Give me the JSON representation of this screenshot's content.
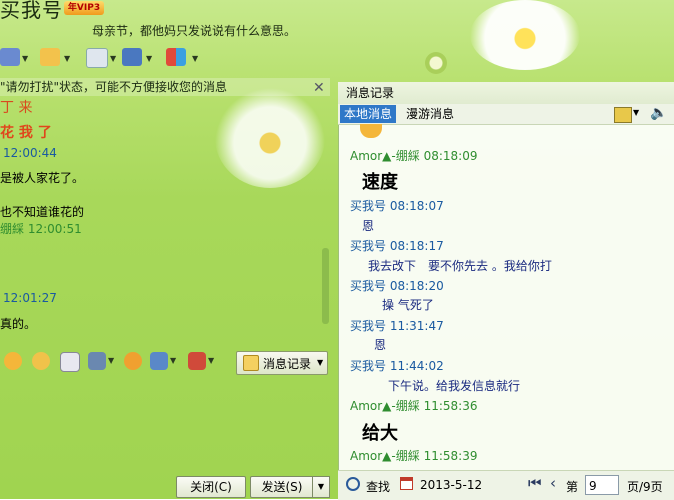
{
  "header": {
    "contact_name": "买我号",
    "vip_badge": "年VIP3",
    "signature": "母亲节，都他妈只发说说有什么意思。"
  },
  "notice": {
    "text": "\"请勿打扰\"状态，可能不方便接收您的消息"
  },
  "left_chat": {
    "lines": [
      {
        "text": "丁 来"
      },
      {
        "text": "花 我 了"
      },
      {
        "text": "12:00:44"
      },
      {
        "text": "是被人家花了。"
      },
      {
        "text": "也不知道谁花的"
      },
      {
        "text": "绷綵  12:00:51"
      },
      {
        "text": "12:01:27"
      },
      {
        "text": "真的。"
      }
    ]
  },
  "toolbar": {
    "history_label": "消息记录",
    "close_label": "关闭(C)",
    "send_label": "发送(S)"
  },
  "history_panel": {
    "title": "消息记录",
    "tabs": [
      {
        "label": "本地消息"
      },
      {
        "label": "漫游消息"
      }
    ],
    "messages": [
      {
        "sender": "Amor▲-绷綵",
        "time": "08:18:09",
        "text": "速度"
      },
      {
        "sender": "买我号",
        "time": "08:18:07",
        "text": "恩"
      },
      {
        "sender": "买我号",
        "time": "08:18:17",
        "text": "我去改下　要不你先去 。我给你打"
      },
      {
        "sender": "买我号",
        "time": "08:18:20",
        "text": "操  气死了"
      },
      {
        "sender": "买我号",
        "time": "11:31:47",
        "text": "恩"
      },
      {
        "sender": "买我号",
        "time": "11:44:02",
        "text": "下午说。给我发信息就行"
      },
      {
        "sender": "Amor▲-绷綵",
        "time": "11:58:36",
        "text": "给大"
      },
      {
        "sender": "Amor▲-绷綵",
        "time": "11:58:39",
        "text": ""
      }
    ],
    "bottom": {
      "find_label": "查找",
      "date": "2013-5-12",
      "page_prefix": "第",
      "page_value": "9",
      "page_suffix": "页/9页"
    }
  },
  "colors": {
    "self_color": "#2f8d2f",
    "other_color": "#1a5aa0",
    "active_tab": "#2f78c8"
  }
}
